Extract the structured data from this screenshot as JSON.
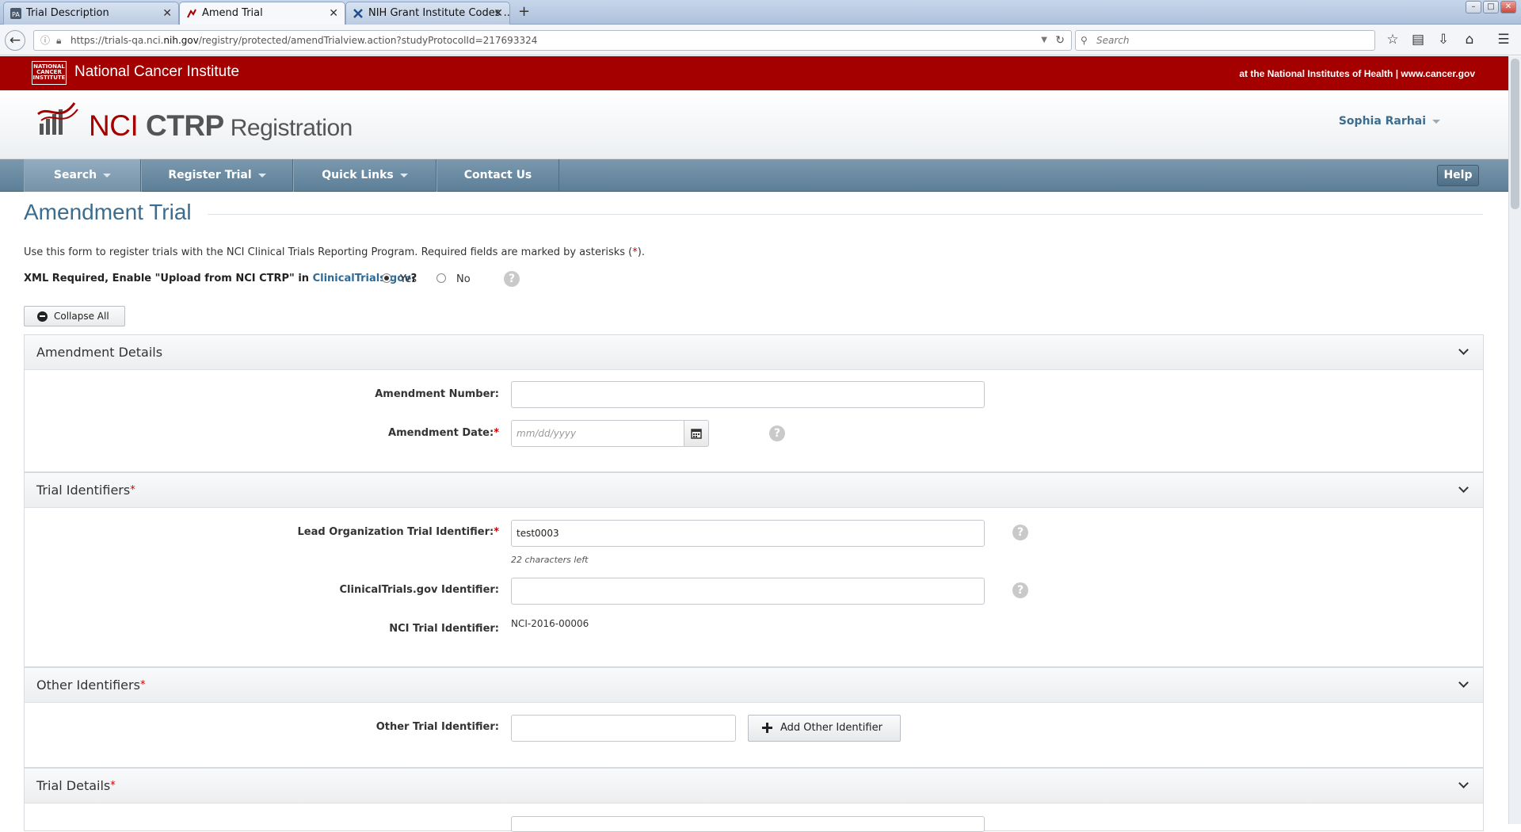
{
  "browser": {
    "tabs": [
      {
        "label": "Trial Description",
        "active": false
      },
      {
        "label": "Amend Trial",
        "active": true
      },
      {
        "label": "NIH Grant Institute Codes ...",
        "active": false
      }
    ],
    "new_tab": "+",
    "url_prefix": "https://trials-qa.nci.",
    "url_domain": "nih.gov",
    "url_rest": "/registry/protected/amendTrialview.action?studyProtocolId=217693324",
    "search_placeholder": "Search"
  },
  "site": {
    "banner_title": "National Cancer Institute",
    "banner_logo_text": "NATIONAL CANCER INSTITUTE",
    "banner_right": "at the National Institutes of Health | www.cancer.gov",
    "logo_nci": "NCI",
    "logo_ctrp": "CTRP",
    "logo_registration": "Registration",
    "user_name": "Sophia Rarhai"
  },
  "nav": {
    "items": [
      {
        "label": "Search"
      },
      {
        "label": "Register Trial"
      },
      {
        "label": "Quick Links"
      },
      {
        "label": "Contact Us"
      }
    ],
    "help": "Help"
  },
  "page": {
    "title": "Amendment Trial",
    "intro": "Use this form to register trials with the NCI Clinical Trials Reporting Program. Required fields are marked by asterisks (",
    "intro_asterisk": "*",
    "intro_end": ").",
    "xml_label": "XML Required, Enable \"Upload from NCI CTRP\" in ",
    "xml_link": "ClinicalTrials.gov",
    "xml_q": "?",
    "xml_yes": "Yes",
    "xml_no": "No",
    "xml_selected": "Yes",
    "collapse_all": "Collapse All"
  },
  "sections": {
    "amendment": {
      "title": "Amendment Details",
      "number_label": "Amendment Number:",
      "number_value": "",
      "date_label": "Amendment Date:",
      "date_placeholder": "mm/dd/yyyy"
    },
    "identifiers": {
      "title": "Trial Identifiers",
      "lead_label": "Lead Organization Trial Identifier:",
      "lead_value": "test0003",
      "lead_hint": "22 characters left",
      "ctgov_label": "ClinicalTrials.gov Identifier:",
      "ctgov_value": "",
      "nci_label": "NCI Trial Identifier:",
      "nci_value": "NCI-2016-00006"
    },
    "other": {
      "title": "Other Identifiers",
      "other_label": "Other Trial Identifier:",
      "other_value": "",
      "add_button": "Add Other Identifier"
    },
    "details": {
      "title": "Trial Details"
    }
  },
  "common": {
    "required_mark": "*",
    "help_mark": "?"
  },
  "colors": {
    "nci_red": "#a50000",
    "nav_blue": "#5c7f98",
    "title_blue": "#3c6d8e"
  }
}
